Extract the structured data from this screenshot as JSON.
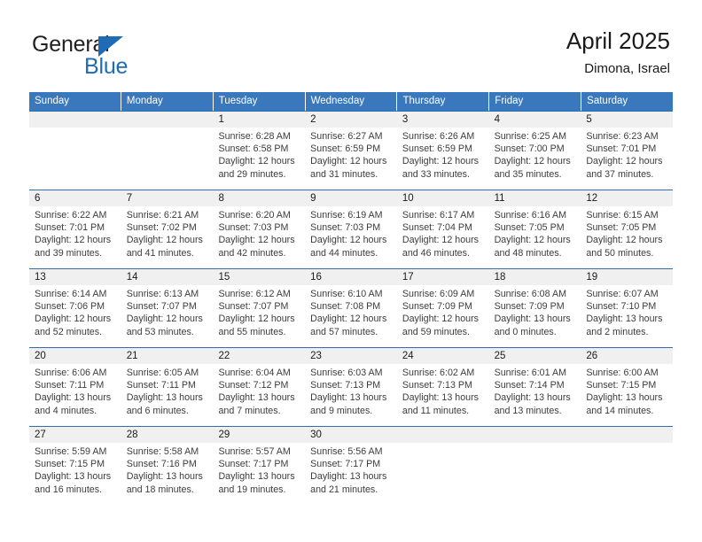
{
  "brand": {
    "name_top": "General",
    "name_bottom": "Blue",
    "triangle_color": "#1d6cb5",
    "text_color": "#231f20"
  },
  "header": {
    "title": "April 2025",
    "subtitle": "Dimona, Israel"
  },
  "theme": {
    "header_bg": "#3a78bd",
    "header_text": "#ffffff",
    "daterow_bg": "#f0f0f0",
    "week_divider": "#2f6cb0",
    "cell_text": "#3c3c3c"
  },
  "weekdays": [
    "Sunday",
    "Monday",
    "Tuesday",
    "Wednesday",
    "Thursday",
    "Friday",
    "Saturday"
  ],
  "labels": {
    "sunrise_prefix": "Sunrise:",
    "sunset_prefix": "Sunset:",
    "daylight_prefix": "Daylight:"
  },
  "weeks": [
    {
      "days": [
        {
          "num": "",
          "sunrise": "",
          "sunset": "",
          "daylight_a": "",
          "daylight_b": "",
          "empty": true
        },
        {
          "num": "",
          "sunrise": "",
          "sunset": "",
          "daylight_a": "",
          "daylight_b": "",
          "empty": true
        },
        {
          "num": "1",
          "sunrise": "Sunrise: 6:28 AM",
          "sunset": "Sunset: 6:58 PM",
          "daylight_a": "Daylight: 12 hours",
          "daylight_b": "and 29 minutes.",
          "empty": false
        },
        {
          "num": "2",
          "sunrise": "Sunrise: 6:27 AM",
          "sunset": "Sunset: 6:59 PM",
          "daylight_a": "Daylight: 12 hours",
          "daylight_b": "and 31 minutes.",
          "empty": false
        },
        {
          "num": "3",
          "sunrise": "Sunrise: 6:26 AM",
          "sunset": "Sunset: 6:59 PM",
          "daylight_a": "Daylight: 12 hours",
          "daylight_b": "and 33 minutes.",
          "empty": false
        },
        {
          "num": "4",
          "sunrise": "Sunrise: 6:25 AM",
          "sunset": "Sunset: 7:00 PM",
          "daylight_a": "Daylight: 12 hours",
          "daylight_b": "and 35 minutes.",
          "empty": false
        },
        {
          "num": "5",
          "sunrise": "Sunrise: 6:23 AM",
          "sunset": "Sunset: 7:01 PM",
          "daylight_a": "Daylight: 12 hours",
          "daylight_b": "and 37 minutes.",
          "empty": false
        }
      ]
    },
    {
      "days": [
        {
          "num": "6",
          "sunrise": "Sunrise: 6:22 AM",
          "sunset": "Sunset: 7:01 PM",
          "daylight_a": "Daylight: 12 hours",
          "daylight_b": "and 39 minutes.",
          "empty": false
        },
        {
          "num": "7",
          "sunrise": "Sunrise: 6:21 AM",
          "sunset": "Sunset: 7:02 PM",
          "daylight_a": "Daylight: 12 hours",
          "daylight_b": "and 41 minutes.",
          "empty": false
        },
        {
          "num": "8",
          "sunrise": "Sunrise: 6:20 AM",
          "sunset": "Sunset: 7:03 PM",
          "daylight_a": "Daylight: 12 hours",
          "daylight_b": "and 42 minutes.",
          "empty": false
        },
        {
          "num": "9",
          "sunrise": "Sunrise: 6:19 AM",
          "sunset": "Sunset: 7:03 PM",
          "daylight_a": "Daylight: 12 hours",
          "daylight_b": "and 44 minutes.",
          "empty": false
        },
        {
          "num": "10",
          "sunrise": "Sunrise: 6:17 AM",
          "sunset": "Sunset: 7:04 PM",
          "daylight_a": "Daylight: 12 hours",
          "daylight_b": "and 46 minutes.",
          "empty": false
        },
        {
          "num": "11",
          "sunrise": "Sunrise: 6:16 AM",
          "sunset": "Sunset: 7:05 PM",
          "daylight_a": "Daylight: 12 hours",
          "daylight_b": "and 48 minutes.",
          "empty": false
        },
        {
          "num": "12",
          "sunrise": "Sunrise: 6:15 AM",
          "sunset": "Sunset: 7:05 PM",
          "daylight_a": "Daylight: 12 hours",
          "daylight_b": "and 50 minutes.",
          "empty": false
        }
      ]
    },
    {
      "days": [
        {
          "num": "13",
          "sunrise": "Sunrise: 6:14 AM",
          "sunset": "Sunset: 7:06 PM",
          "daylight_a": "Daylight: 12 hours",
          "daylight_b": "and 52 minutes.",
          "empty": false
        },
        {
          "num": "14",
          "sunrise": "Sunrise: 6:13 AM",
          "sunset": "Sunset: 7:07 PM",
          "daylight_a": "Daylight: 12 hours",
          "daylight_b": "and 53 minutes.",
          "empty": false
        },
        {
          "num": "15",
          "sunrise": "Sunrise: 6:12 AM",
          "sunset": "Sunset: 7:07 PM",
          "daylight_a": "Daylight: 12 hours",
          "daylight_b": "and 55 minutes.",
          "empty": false
        },
        {
          "num": "16",
          "sunrise": "Sunrise: 6:10 AM",
          "sunset": "Sunset: 7:08 PM",
          "daylight_a": "Daylight: 12 hours",
          "daylight_b": "and 57 minutes.",
          "empty": false
        },
        {
          "num": "17",
          "sunrise": "Sunrise: 6:09 AM",
          "sunset": "Sunset: 7:09 PM",
          "daylight_a": "Daylight: 12 hours",
          "daylight_b": "and 59 minutes.",
          "empty": false
        },
        {
          "num": "18",
          "sunrise": "Sunrise: 6:08 AM",
          "sunset": "Sunset: 7:09 PM",
          "daylight_a": "Daylight: 13 hours",
          "daylight_b": "and 0 minutes.",
          "empty": false
        },
        {
          "num": "19",
          "sunrise": "Sunrise: 6:07 AM",
          "sunset": "Sunset: 7:10 PM",
          "daylight_a": "Daylight: 13 hours",
          "daylight_b": "and 2 minutes.",
          "empty": false
        }
      ]
    },
    {
      "days": [
        {
          "num": "20",
          "sunrise": "Sunrise: 6:06 AM",
          "sunset": "Sunset: 7:11 PM",
          "daylight_a": "Daylight: 13 hours",
          "daylight_b": "and 4 minutes.",
          "empty": false
        },
        {
          "num": "21",
          "sunrise": "Sunrise: 6:05 AM",
          "sunset": "Sunset: 7:11 PM",
          "daylight_a": "Daylight: 13 hours",
          "daylight_b": "and 6 minutes.",
          "empty": false
        },
        {
          "num": "22",
          "sunrise": "Sunrise: 6:04 AM",
          "sunset": "Sunset: 7:12 PM",
          "daylight_a": "Daylight: 13 hours",
          "daylight_b": "and 7 minutes.",
          "empty": false
        },
        {
          "num": "23",
          "sunrise": "Sunrise: 6:03 AM",
          "sunset": "Sunset: 7:13 PM",
          "daylight_a": "Daylight: 13 hours",
          "daylight_b": "and 9 minutes.",
          "empty": false
        },
        {
          "num": "24",
          "sunrise": "Sunrise: 6:02 AM",
          "sunset": "Sunset: 7:13 PM",
          "daylight_a": "Daylight: 13 hours",
          "daylight_b": "and 11 minutes.",
          "empty": false
        },
        {
          "num": "25",
          "sunrise": "Sunrise: 6:01 AM",
          "sunset": "Sunset: 7:14 PM",
          "daylight_a": "Daylight: 13 hours",
          "daylight_b": "and 13 minutes.",
          "empty": false
        },
        {
          "num": "26",
          "sunrise": "Sunrise: 6:00 AM",
          "sunset": "Sunset: 7:15 PM",
          "daylight_a": "Daylight: 13 hours",
          "daylight_b": "and 14 minutes.",
          "empty": false
        }
      ]
    },
    {
      "days": [
        {
          "num": "27",
          "sunrise": "Sunrise: 5:59 AM",
          "sunset": "Sunset: 7:15 PM",
          "daylight_a": "Daylight: 13 hours",
          "daylight_b": "and 16 minutes.",
          "empty": false
        },
        {
          "num": "28",
          "sunrise": "Sunrise: 5:58 AM",
          "sunset": "Sunset: 7:16 PM",
          "daylight_a": "Daylight: 13 hours",
          "daylight_b": "and 18 minutes.",
          "empty": false
        },
        {
          "num": "29",
          "sunrise": "Sunrise: 5:57 AM",
          "sunset": "Sunset: 7:17 PM",
          "daylight_a": "Daylight: 13 hours",
          "daylight_b": "and 19 minutes.",
          "empty": false
        },
        {
          "num": "30",
          "sunrise": "Sunrise: 5:56 AM",
          "sunset": "Sunset: 7:17 PM",
          "daylight_a": "Daylight: 13 hours",
          "daylight_b": "and 21 minutes.",
          "empty": false
        },
        {
          "num": "",
          "sunrise": "",
          "sunset": "",
          "daylight_a": "",
          "daylight_b": "",
          "empty": true
        },
        {
          "num": "",
          "sunrise": "",
          "sunset": "",
          "daylight_a": "",
          "daylight_b": "",
          "empty": true
        },
        {
          "num": "",
          "sunrise": "",
          "sunset": "",
          "daylight_a": "",
          "daylight_b": "",
          "empty": true
        }
      ]
    }
  ]
}
